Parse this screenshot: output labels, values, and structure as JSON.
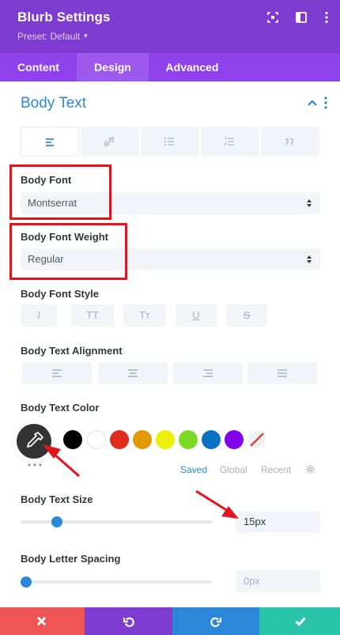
{
  "header": {
    "title": "Blurb Settings",
    "preset": "Preset: Default",
    "icons": [
      "focus-icon",
      "split-view-icon",
      "more-vertical-icon"
    ]
  },
  "tabs": [
    {
      "label": "Content",
      "active": false
    },
    {
      "label": "Design",
      "active": true
    },
    {
      "label": "Advanced",
      "active": false
    }
  ],
  "section": {
    "title": "Body Text",
    "subtabs": [
      "paragraph-icon",
      "link-icon",
      "unordered-list-icon",
      "ordered-list-icon",
      "blockquote-icon"
    ]
  },
  "body_font": {
    "label": "Body Font",
    "value": "Montserrat"
  },
  "body_font_weight": {
    "label": "Body Font Weight",
    "value": "Regular"
  },
  "body_font_style": {
    "label": "Body Font Style",
    "buttons": [
      "I",
      "TT",
      "Tт",
      "U",
      "S"
    ]
  },
  "body_text_alignment": {
    "label": "Body Text Alignment",
    "options": [
      "align-left",
      "align-center",
      "align-right",
      "justify"
    ]
  },
  "body_text_color": {
    "label": "Body Text Color",
    "swatches": [
      "#000000",
      "#ffffff",
      "#e02b20",
      "#e09900",
      "#edf000",
      "#7cda24",
      "#0c71c3",
      "#8300e9"
    ],
    "tabs": [
      "Saved",
      "Global",
      "Recent"
    ],
    "active_tab": "Saved"
  },
  "body_text_size": {
    "label": "Body Text Size",
    "value": "15px",
    "slider_fraction": 0.17
  },
  "body_letter_spacing": {
    "label": "Body Letter Spacing",
    "value": "0px",
    "slider_fraction": 0.0
  },
  "footer": {
    "buttons": [
      {
        "name": "discard-button",
        "icon": "close-icon",
        "color": "#ef5555"
      },
      {
        "name": "undo-button",
        "icon": "undo-icon",
        "color": "#7e3bd0"
      },
      {
        "name": "redo-button",
        "icon": "redo-icon",
        "color": "#2b87da"
      },
      {
        "name": "save-button",
        "icon": "check-icon",
        "color": "#29c4a9"
      }
    ]
  },
  "colors": {
    "header": "#7e3bd0",
    "tabbar": "#8f42ec",
    "accent": "#2b87da",
    "highlight": "#e5141b"
  }
}
